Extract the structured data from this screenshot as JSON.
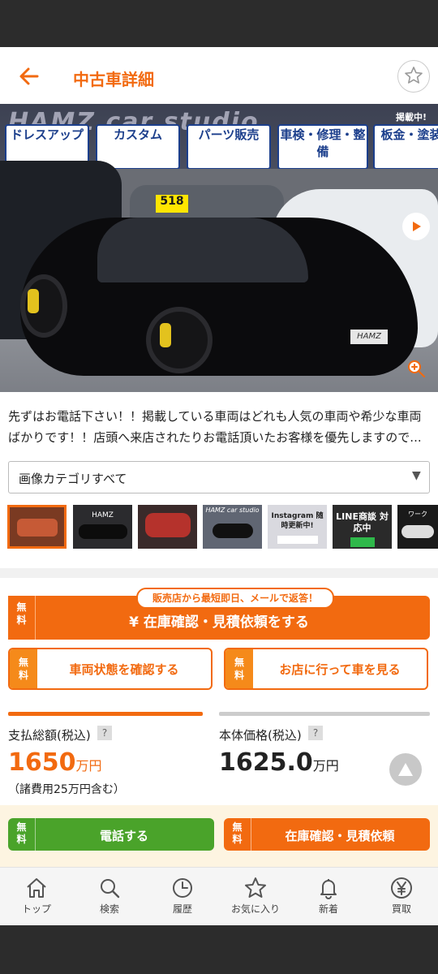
{
  "header": {
    "back_icon": "arrow-left-icon",
    "title": "中古車詳細",
    "favorite_icon": "star-icon"
  },
  "hero": {
    "banner_text": "HAMZ car studio",
    "badge_text": "掲載中!",
    "signs": [
      "ドレスアップ",
      "カスタム",
      "パーツ販売",
      "車検・修理・整備",
      "板金・塗装"
    ],
    "plate_text": "HAMZ",
    "price_sticker": "518"
  },
  "description": "先ずはお電話下さい！！掲載している車両はどれも人気の車両や希少な車両ばかりです！！店頭へ来店されたりお電話頂いたお客様を優先しますので...",
  "image_category": {
    "selected": "画像カテゴリすべて"
  },
  "thumbnails": [
    {
      "label": ""
    },
    {
      "label": "HAMZ"
    },
    {
      "label": ""
    },
    {
      "label": "HAMZ car studio"
    },
    {
      "label": "Instagram 随時更新中!"
    },
    {
      "label": "LINE商談 対応中"
    },
    {
      "label": "ワーク"
    }
  ],
  "inquiry": {
    "bubble": "販売店から最短即日、メールで返答！",
    "free_badge": "無料",
    "main_label": "¥ 在庫確認・見積依頼をする",
    "check_condition": "車両状態を確認する",
    "visit_store": "お店に行って車を見る"
  },
  "price": {
    "total_label": "支払総額(税込)",
    "total_value": "1650",
    "total_unit": "万円",
    "total_note": "（諸費用25万円含む）",
    "body_label": "本体価格(税込)",
    "body_value": "1625.0",
    "body_unit": "万円",
    "help_mark": "?"
  },
  "cta": {
    "free_badge": "無料",
    "call": "電話する",
    "estimate": "在庫確認・見積依頼"
  },
  "tabs": [
    {
      "label": "トップ",
      "icon": "home-icon"
    },
    {
      "label": "検索",
      "icon": "search-icon"
    },
    {
      "label": "履歴",
      "icon": "clock-icon"
    },
    {
      "label": "お気に入り",
      "icon": "star-icon"
    },
    {
      "label": "新着",
      "icon": "bell-icon"
    },
    {
      "label": "買取",
      "icon": "yen-icon"
    }
  ],
  "colors": {
    "accent": "#f26a10",
    "green": "#4aa32a",
    "cta_bg": "#fdf4e1"
  }
}
